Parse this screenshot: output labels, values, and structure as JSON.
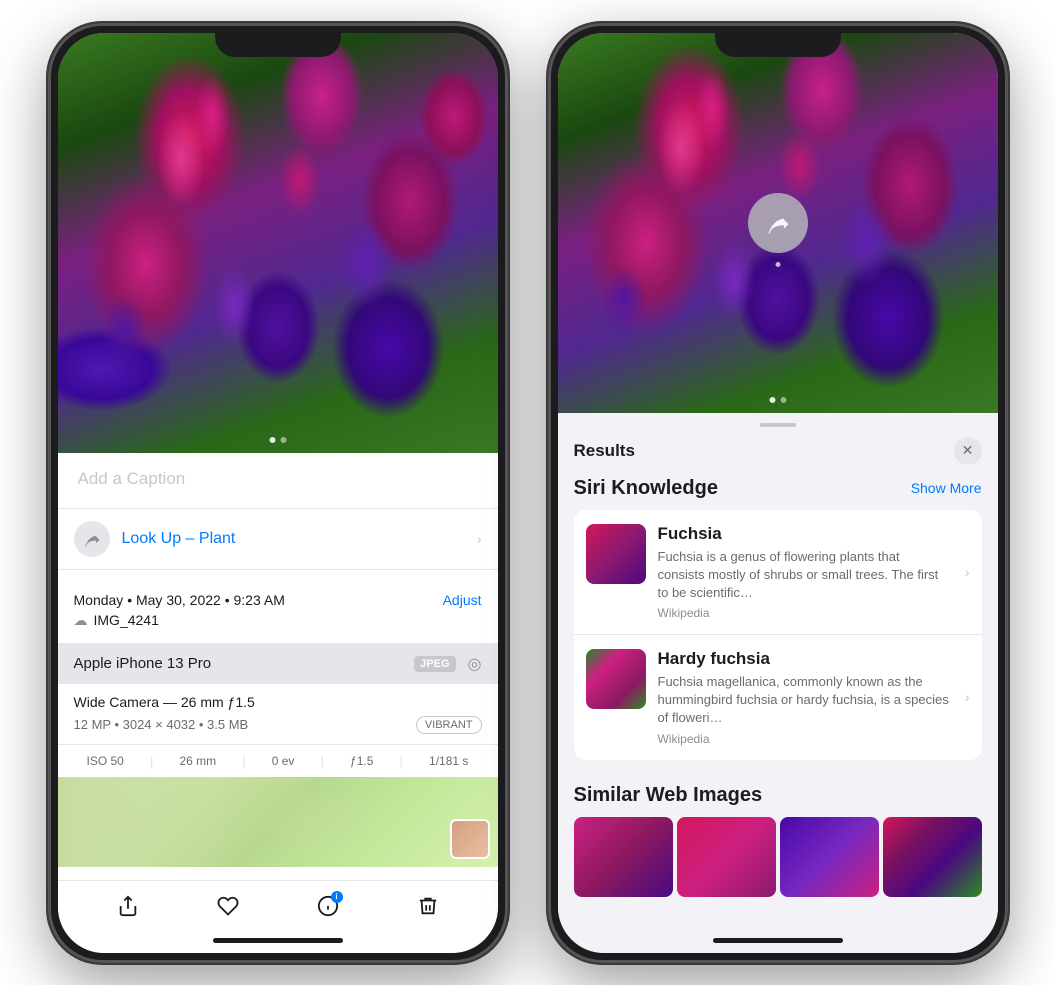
{
  "phone1": {
    "caption_placeholder": "Add a Caption",
    "lookup_label": "Look Up –",
    "lookup_type": "Plant",
    "date": "Monday • May 30, 2022 • 9:23 AM",
    "adjust_label": "Adjust",
    "filename": "IMG_4241",
    "device_name": "Apple iPhone 13 Pro",
    "format_badge": "JPEG",
    "camera_wide": "Wide Camera — 26 mm ƒ1.5",
    "camera_mp": "12 MP • 3024 × 4032 • 3.5 MB",
    "vibrant_badge": "VIBRANT",
    "iso": "ISO 50",
    "focal": "26 mm",
    "ev": "0 ev",
    "aperture": "ƒ1.5",
    "shutter": "1/181 s",
    "toolbar": {
      "share_label": "⬆",
      "favorite_label": "♡",
      "info_label": "✦",
      "delete_label": "🗑"
    }
  },
  "phone2": {
    "results_title": "Results",
    "close_label": "✕",
    "siri_knowledge_title": "Siri Knowledge",
    "show_more_label": "Show More",
    "items": [
      {
        "title": "Fuchsia",
        "description": "Fuchsia is a genus of flowering plants that consists mostly of shrubs or small trees. The first to be scientific…",
        "source": "Wikipedia"
      },
      {
        "title": "Hardy fuchsia",
        "description": "Fuchsia magellanica, commonly known as the hummingbird fuchsia or hardy fuchsia, is a species of floweri…",
        "source": "Wikipedia"
      }
    ],
    "similar_title": "Similar Web Images"
  }
}
